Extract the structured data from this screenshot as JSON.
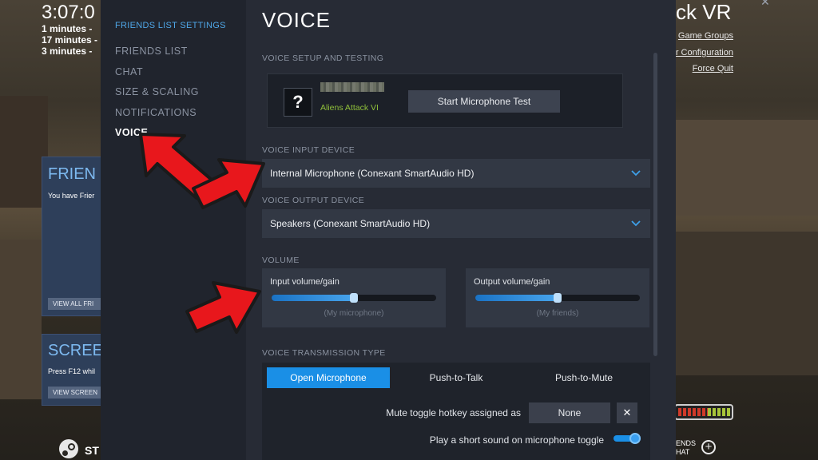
{
  "background": {
    "clock": "3:07:0",
    "recent": [
      "1 minutes -",
      "17 minutes -",
      "3 minutes -"
    ],
    "friends_heading": "FRIEN",
    "friends_text": "You have  Frier",
    "view_all_btn": "VIEW ALL FRI",
    "screenshots_heading": "SCREE",
    "screenshots_text": "Press F12 whil",
    "view_screens_btn": "VIEW SCREEN",
    "steam_label": "ST",
    "game_title": "ck VR",
    "links": [
      "Game Groups",
      "er Configuration",
      "Force Quit"
    ],
    "friends_chat_line1": "ENDS",
    "friends_chat_line2": "HAT"
  },
  "sidebar": {
    "header": "FRIENDS LIST SETTINGS",
    "items": [
      {
        "label": "FRIENDS LIST",
        "active": false
      },
      {
        "label": "CHAT",
        "active": false
      },
      {
        "label": "SIZE & SCALING",
        "active": false
      },
      {
        "label": "NOTIFICATIONS",
        "active": false
      },
      {
        "label": "VOICE",
        "active": true
      }
    ]
  },
  "main": {
    "title": "VOICE",
    "setup": {
      "section_label": "VOICE SETUP AND TESTING",
      "avatar_glyph": "?",
      "game": "Aliens Attack VI",
      "mic_test_button": "Start Microphone Test"
    },
    "input_device": {
      "section_label": "VOICE INPUT DEVICE",
      "value": "Internal Microphone (Conexant SmartAudio HD)"
    },
    "output_device": {
      "section_label": "VOICE OUTPUT DEVICE",
      "value": "Speakers (Conexant SmartAudio HD)"
    },
    "volume": {
      "section_label": "VOLUME",
      "input": {
        "label": "Input volume/gain",
        "sub": "(My microphone)",
        "level": 0.5
      },
      "output": {
        "label": "Output volume/gain",
        "sub": "(My friends)",
        "level": 0.5
      }
    },
    "transmission": {
      "section_label": "VOICE TRANSMISSION TYPE",
      "tabs": [
        {
          "label": "Open Microphone",
          "active": true
        },
        {
          "label": "Push-to-Talk",
          "active": false
        },
        {
          "label": "Push-to-Mute",
          "active": false
        }
      ],
      "hotkey_label": "Mute toggle hotkey assigned as",
      "hotkey_value": "None",
      "hotkey_clear": "✕",
      "sound_toggle_label": "Play a short sound on microphone toggle",
      "sound_toggle_on": true
    }
  },
  "colors": {
    "accent": "#1a8fe6",
    "sidebar_header": "#4fa7e8",
    "arrow": "#e8171c"
  }
}
